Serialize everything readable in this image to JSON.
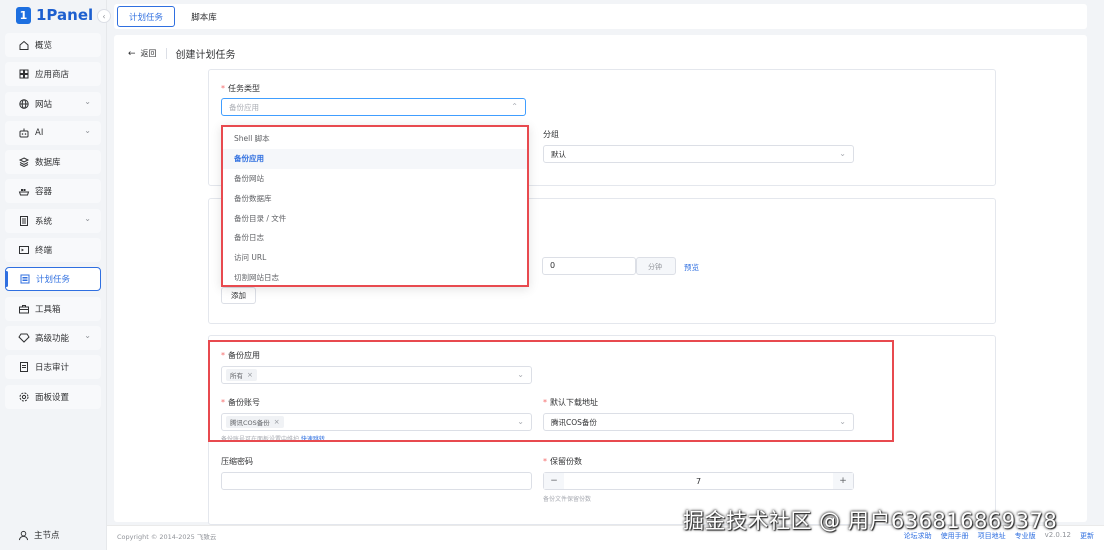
{
  "app": {
    "name": "1Panel",
    "collapse_icon": "chevron-left-icon"
  },
  "sidebar": {
    "items": [
      {
        "label": "概览",
        "icon": "home-icon"
      },
      {
        "label": "应用商店",
        "icon": "grid-icon"
      },
      {
        "label": "网站",
        "icon": "globe-icon",
        "chevron": true
      },
      {
        "label": "AI",
        "icon": "robot-icon",
        "chevron": true
      },
      {
        "label": "数据库",
        "icon": "layers-icon"
      },
      {
        "label": "容器",
        "icon": "container-icon"
      },
      {
        "label": "系统",
        "icon": "server-icon",
        "chevron": true
      },
      {
        "label": "终端",
        "icon": "terminal-icon"
      },
      {
        "label": "计划任务",
        "icon": "list-icon",
        "active": true
      },
      {
        "label": "工具箱",
        "icon": "toolbox-icon"
      },
      {
        "label": "高级功能",
        "icon": "diamond-icon",
        "chevron": true
      },
      {
        "label": "日志审计",
        "icon": "document-icon"
      },
      {
        "label": "面板设置",
        "icon": "gear-icon"
      }
    ],
    "node_label": "主节点"
  },
  "tabs": [
    {
      "label": "计划任务"
    },
    {
      "label": "脚本库"
    }
  ],
  "header": {
    "back_label": "返回",
    "title": "创建计划任务"
  },
  "form": {
    "task_type": {
      "label": "任务类型",
      "placeholder": "备份应用"
    },
    "group": {
      "label": "分组",
      "value": "默认"
    },
    "minutes": {
      "value": "0",
      "unit": "分钟",
      "preview": "预览"
    },
    "add_button": "添加",
    "backup_app": {
      "label": "备份应用",
      "tag": "所有"
    },
    "backup_account": {
      "label": "备份账号",
      "tag": "腾讯COS备份",
      "hint": "备份账号可在面板设置中维护,",
      "hint_link": "快速跳转"
    },
    "default_download": {
      "label": "默认下载地址",
      "value": "腾讯COS备份"
    },
    "compress_password": {
      "label": "压缩密码"
    },
    "retain_copies": {
      "label": "保留份数",
      "value": "7",
      "hint": "备份文件保留份数"
    }
  },
  "dropdown": {
    "options": [
      {
        "label": "Shell 脚本"
      },
      {
        "label": "备份应用",
        "selected": true
      },
      {
        "label": "备份网站"
      },
      {
        "label": "备份数据库"
      },
      {
        "label": "备份目录 / 文件"
      },
      {
        "label": "备份日志"
      },
      {
        "label": "访问 URL"
      },
      {
        "label": "切割网站日志"
      }
    ]
  },
  "footer": {
    "copyright": "Copyright © 2014-2025 飞致云",
    "links": [
      "论坛求助",
      "使用手册",
      "项目地址",
      "专业版"
    ],
    "version": "v2.0.12",
    "update": "更新"
  },
  "watermark": "掘金技术社区 @ 用户636816869378",
  "colors": {
    "accent": "#2f6fe0",
    "highlight_border": "#e84a4f"
  }
}
